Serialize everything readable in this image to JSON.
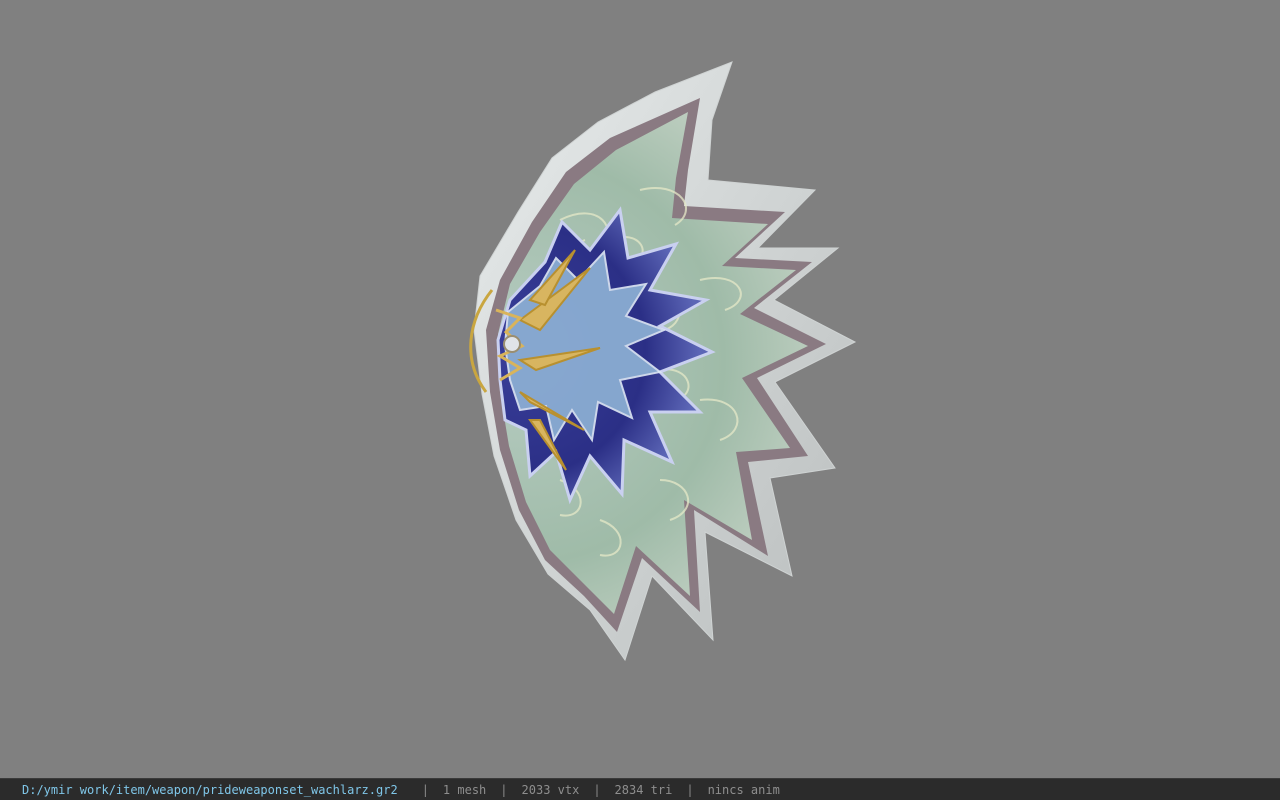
{
  "viewer": {
    "background_color": "#808080",
    "model_name": "prideweaponset_wachlarz"
  },
  "status_bar": {
    "file_path": "D:/ymir work/item/weapon/prideweaponset_wachlarz.gr2",
    "separator": "|",
    "mesh_count": "1 mesh",
    "vertex_count": "2033 vtx",
    "triangle_count": "2834 tri",
    "animation": "nincs anim",
    "path_color": "#7fc6e8",
    "bar_color": "#2b2b2b"
  }
}
